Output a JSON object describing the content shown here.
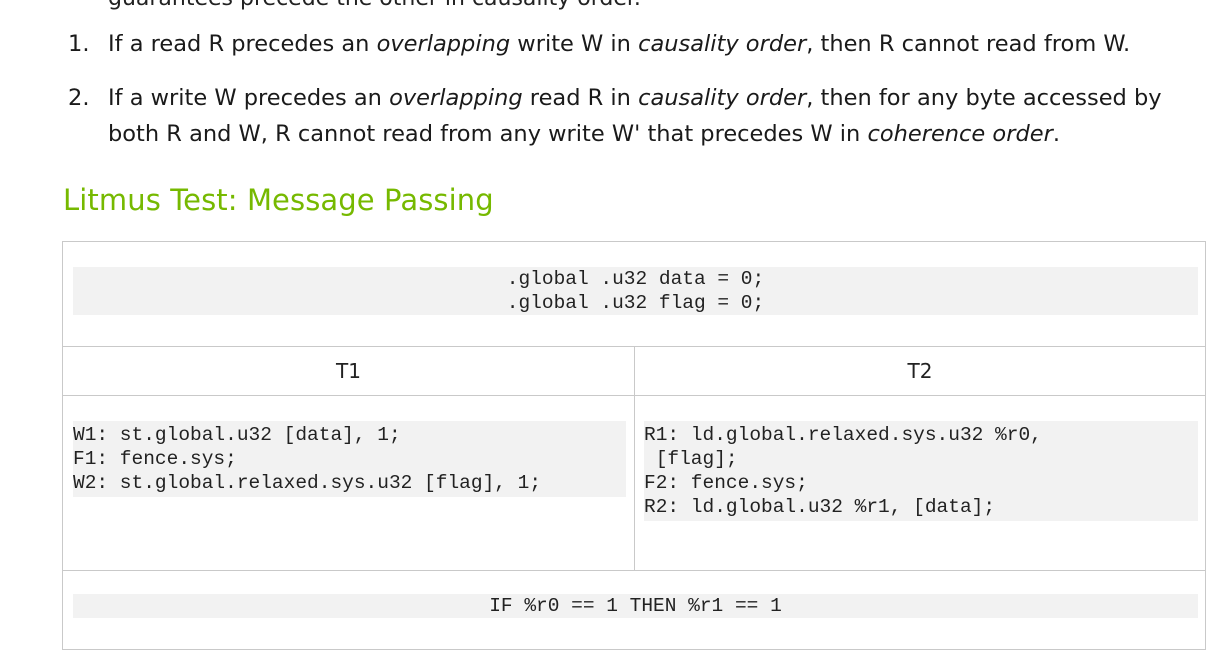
{
  "top_partial_line": "guarantees precede the other in causality order.",
  "axioms": [
    {
      "number": "1.",
      "parts": [
        {
          "text": "If a read R precedes an ",
          "italic": false
        },
        {
          "text": "overlapping",
          "italic": true
        },
        {
          "text": " write W in ",
          "italic": false
        },
        {
          "text": "causality order",
          "italic": true
        },
        {
          "text": ", then R cannot read from W.",
          "italic": false
        }
      ]
    },
    {
      "number": "2.",
      "parts": [
        {
          "text": "If a write W precedes an ",
          "italic": false
        },
        {
          "text": "overlapping",
          "italic": true
        },
        {
          "text": " read R in ",
          "italic": false
        },
        {
          "text": "causality order",
          "italic": true
        },
        {
          "text": ", then for any byte accessed by both R and W, R cannot read from any write W' that precedes W in ",
          "italic": false
        },
        {
          "text": "coherence order",
          "italic": true
        },
        {
          "text": ".",
          "italic": false
        }
      ]
    }
  ],
  "section_title": "Litmus Test: Message Passing",
  "litmus": {
    "init": [
      ".global .u32 data = 0;",
      ".global .u32 flag = 0;"
    ],
    "headers": {
      "t1": "T1",
      "t2": "T2"
    },
    "t1_code": [
      "W1: st.global.u32 [data], 1;",
      "F1: fence.sys;",
      "W2: st.global.relaxed.sys.u32 [flag], 1;"
    ],
    "t2_code": [
      "R1: ld.global.relaxed.sys.u32 %r0,",
      " [flag];",
      "F2: fence.sys;",
      "R2: ld.global.u32 %r1, [data];"
    ],
    "condition": "IF %r0 == 1 THEN %r1 == 1"
  }
}
